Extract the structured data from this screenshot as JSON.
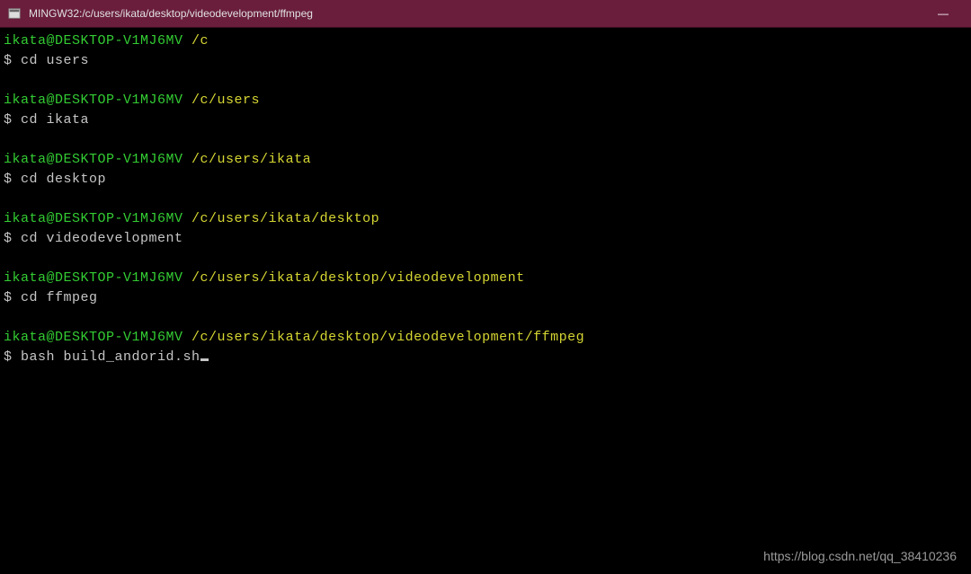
{
  "titlebar": {
    "title": "MINGW32:/c/users/ikata/desktop/videodevelopment/ffmpeg",
    "minimize": "—"
  },
  "prompt_user": "ikata@DESKTOP-V1MJ6MV",
  "blocks": [
    {
      "path": "/c",
      "cmd": "cd users"
    },
    {
      "path": "/c/users",
      "cmd": "cd ikata"
    },
    {
      "path": "/c/users/ikata",
      "cmd": "cd desktop"
    },
    {
      "path": "/c/users/ikata/desktop",
      "cmd": "cd videodevelopment"
    },
    {
      "path": "/c/users/ikata/desktop/videodevelopment",
      "cmd": "cd ffmpeg"
    },
    {
      "path": "/c/users/ikata/desktop/videodevelopment/ffmpeg",
      "cmd": "bash build_andorid.sh"
    }
  ],
  "watermark": "https://blog.csdn.net/qq_38410236"
}
